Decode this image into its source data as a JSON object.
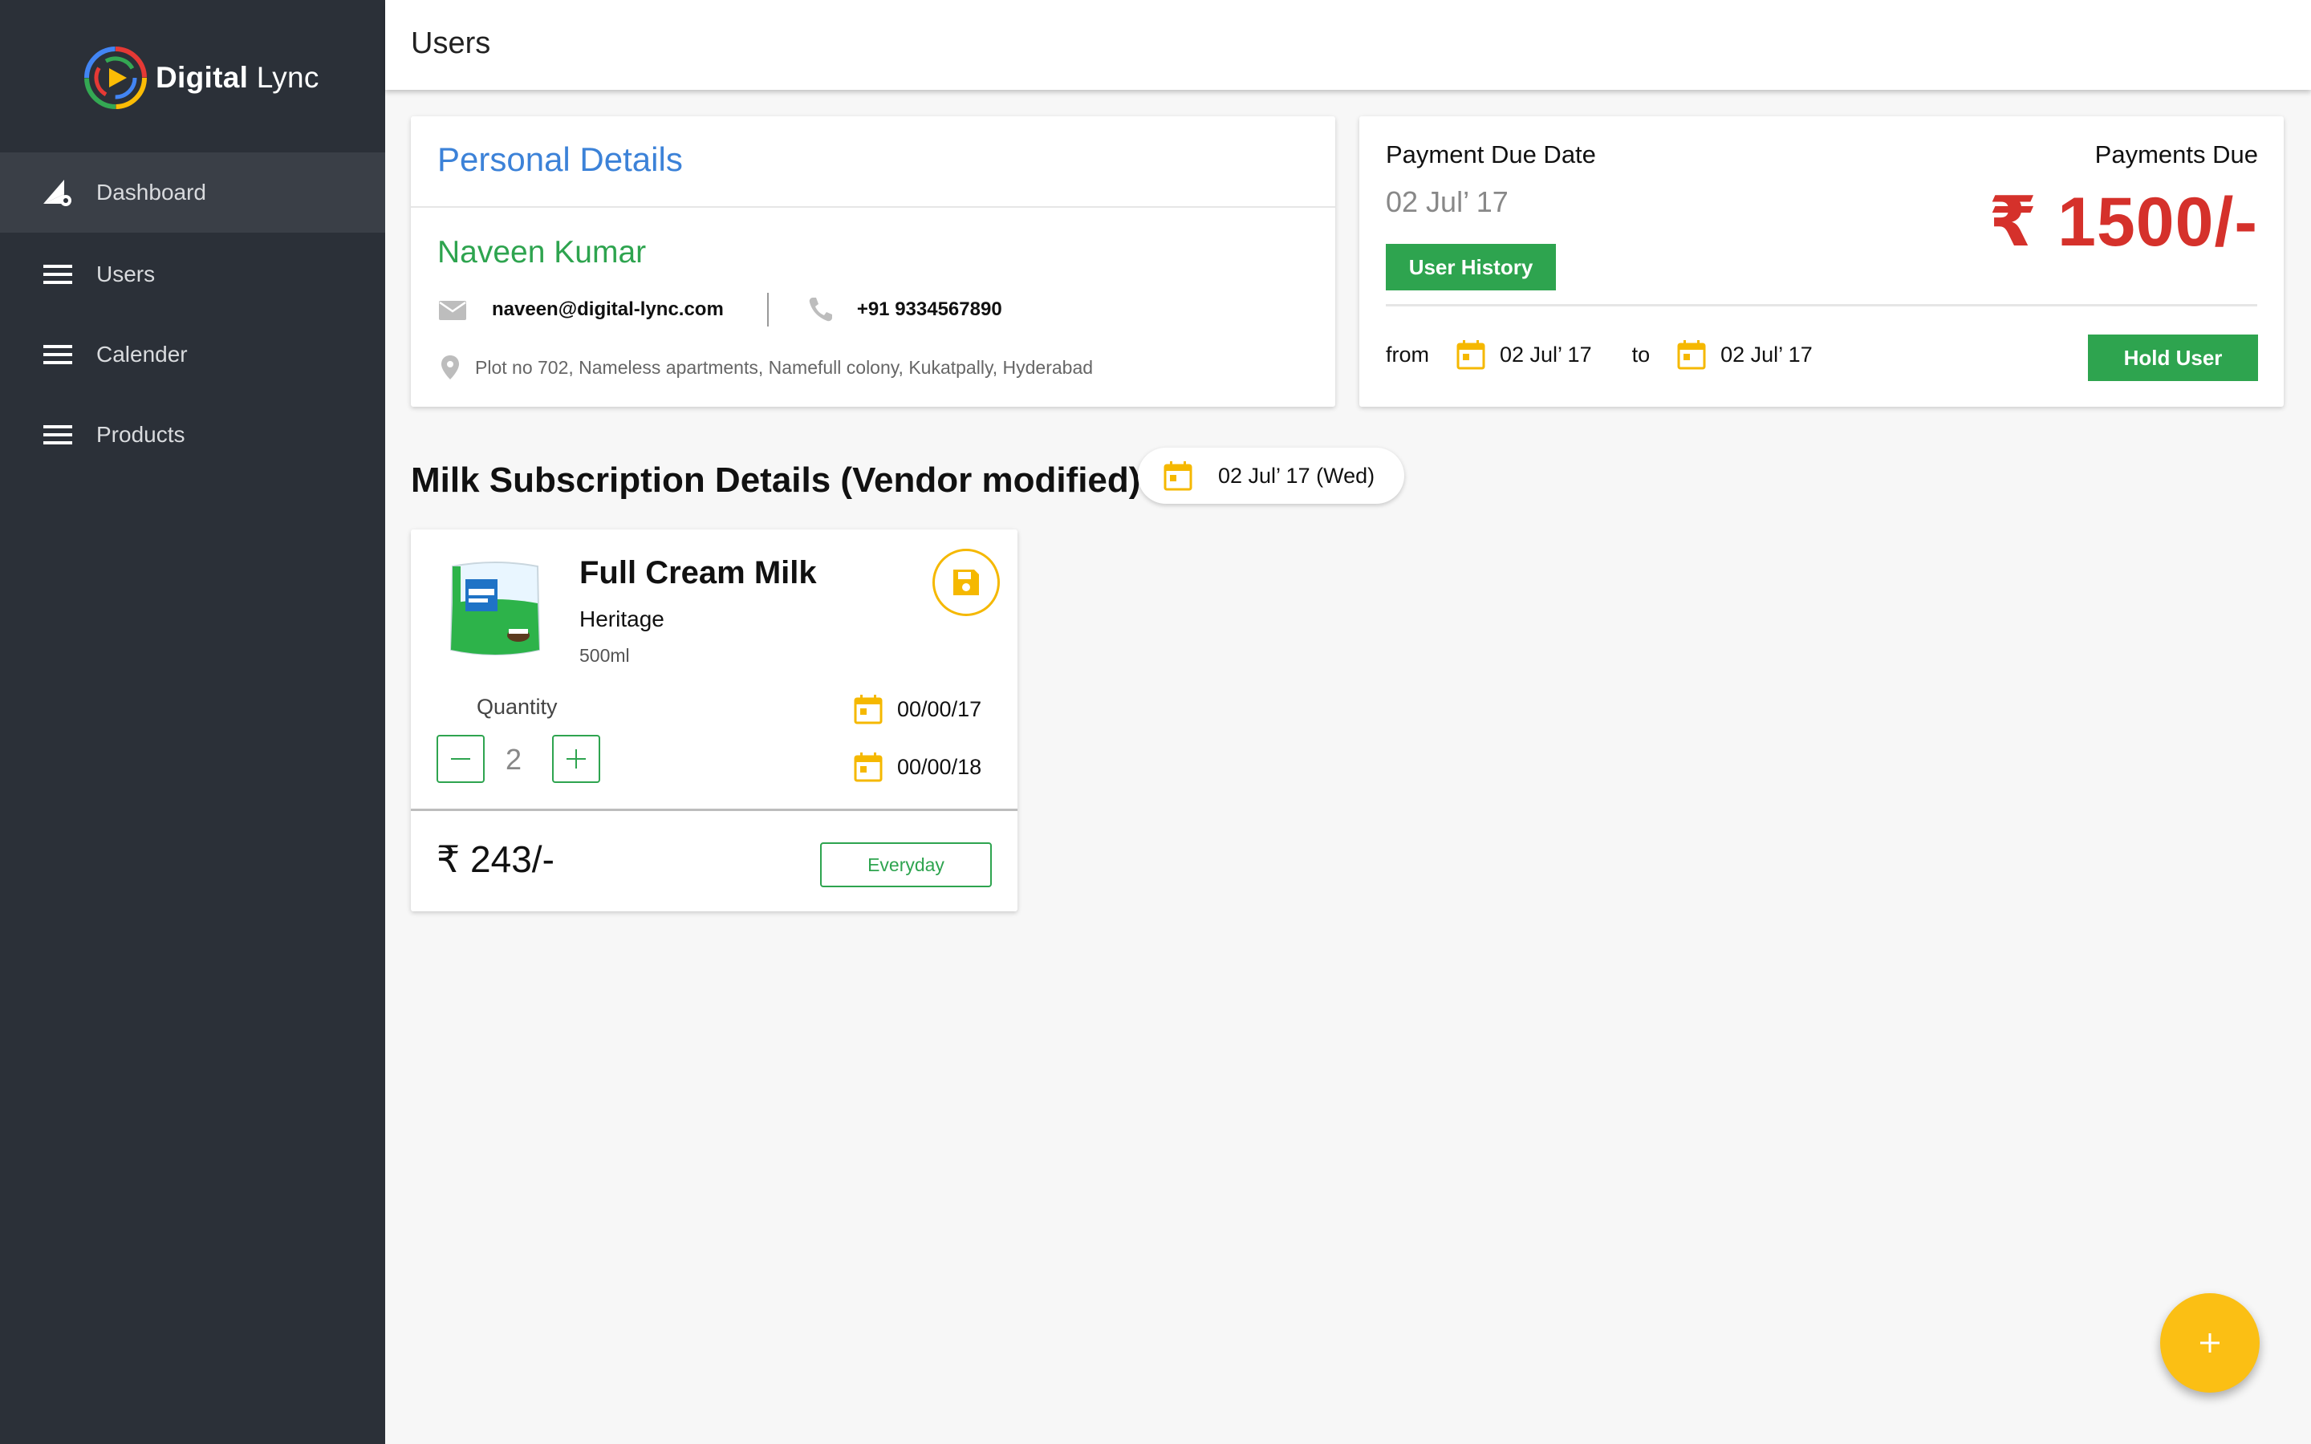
{
  "brand": {
    "name_bold": "Digital",
    "name_light": " Lync"
  },
  "sidebar": {
    "items": [
      {
        "label": "Dashboard",
        "icon": "dashboard-settings-icon",
        "active": true
      },
      {
        "label": "Users",
        "icon": "menu-icon"
      },
      {
        "label": "Calender",
        "icon": "menu-icon"
      },
      {
        "label": "Products",
        "icon": "menu-icon"
      }
    ]
  },
  "header": {
    "title": "Users"
  },
  "personal": {
    "title": "Personal Details",
    "name": "Naveen Kumar",
    "email": "naveen@digital-lync.com",
    "phone": "+91 9334567890",
    "address": "Plot no 702, Nameless apartments, Namefull colony, Kukatpally, Hyderabad"
  },
  "payment": {
    "due_date_label": "Payment Due Date",
    "due_date": "02 Jul’ 17",
    "user_history_label": "User History",
    "amount_label": "Payments Due",
    "amount": "₹ 1500/-",
    "from_label": "from",
    "from_date": "02 Jul’ 17",
    "to_label": "to",
    "to_date": "02 Jul’ 17",
    "hold_label": "Hold User"
  },
  "subscription": {
    "title": "Milk Subscription Details (Vendor modified)",
    "date": "02 Jul’ 17 (Wed)"
  },
  "product": {
    "name": "Full Cream Milk",
    "brand": "Heritage",
    "size": "500ml",
    "quantity_label": "Quantity",
    "quantity": "2",
    "start_date": "00/00/17",
    "end_date": "00/00/18",
    "price": "₹ 243/-",
    "frequency": "Everyday"
  },
  "colors": {
    "sidebar_bg": "#2b3038",
    "accent_blue": "#3c82d8",
    "accent_green": "#2ea44f",
    "accent_red": "#d5312b",
    "accent_yellow": "#fbbf14"
  }
}
